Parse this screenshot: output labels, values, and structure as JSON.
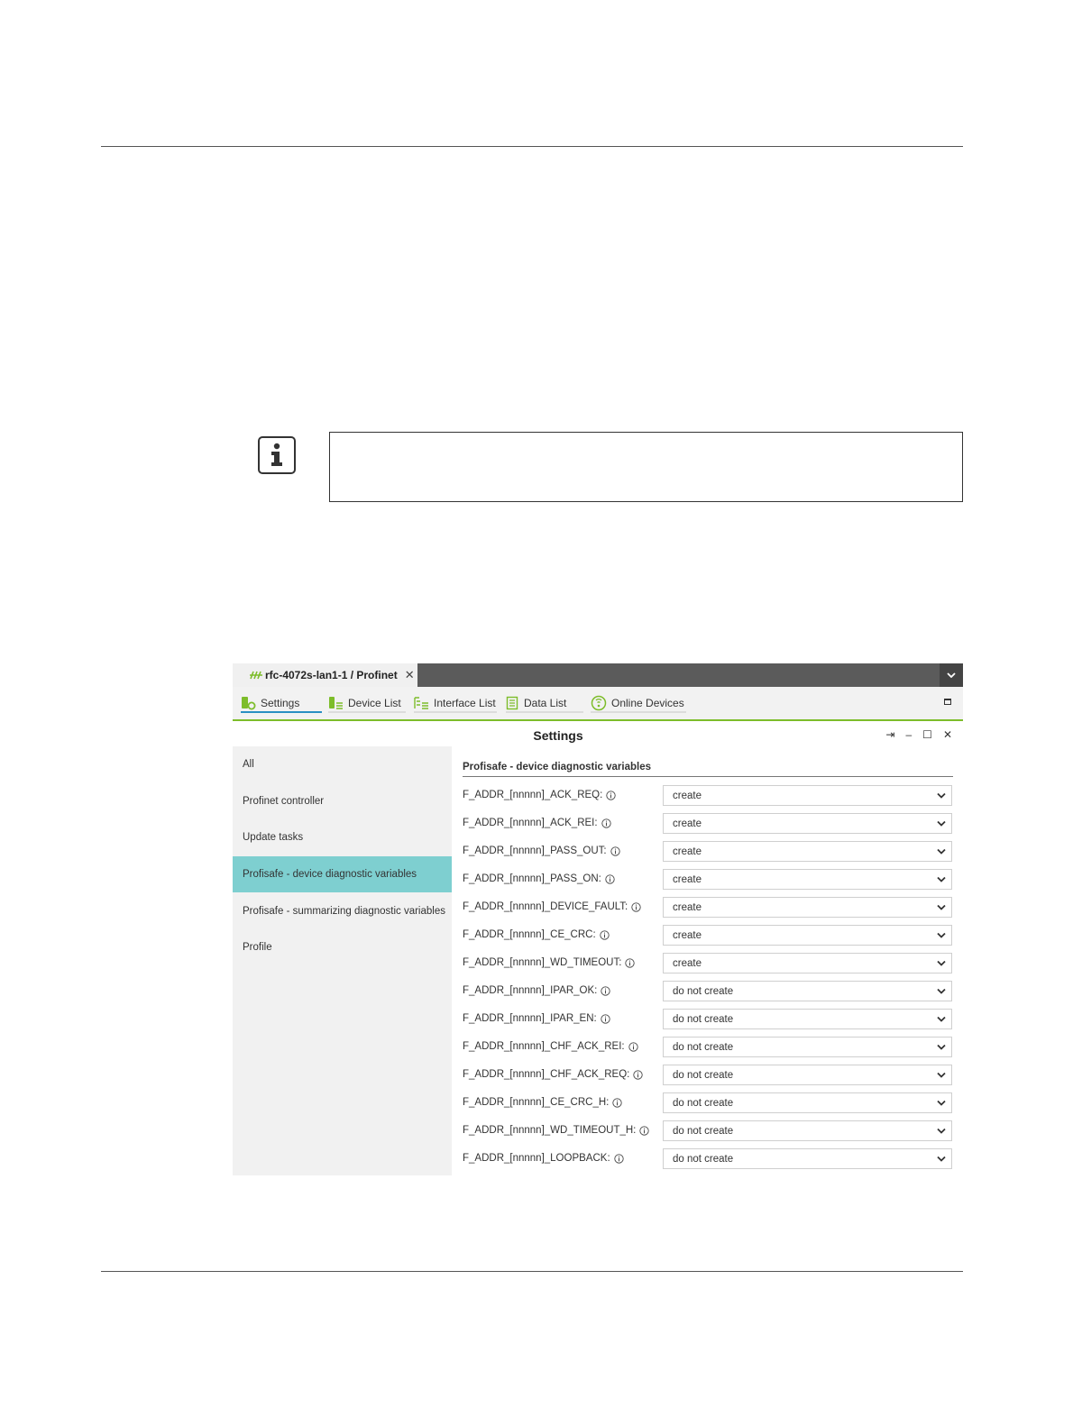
{
  "app": {
    "document_tab": {
      "title": "rfc-4072s-lan1-1 / Profinet"
    },
    "toolbar": {
      "tabs": [
        {
          "label": "Settings",
          "active": true
        },
        {
          "label": "Device List",
          "active": false
        },
        {
          "label": "Interface List",
          "active": false
        },
        {
          "label": "Data List",
          "active": false
        },
        {
          "label": "Online Devices",
          "active": false
        }
      ]
    },
    "panel": {
      "title": "Settings"
    },
    "sidebar": {
      "items": [
        {
          "label": "All",
          "selected": false
        },
        {
          "label": "Profinet controller",
          "selected": false
        },
        {
          "label": "Update tasks",
          "selected": false
        },
        {
          "label": "Profisafe - device diagnostic variables",
          "selected": true
        },
        {
          "label": "Profisafe - summarizing diagnostic variables",
          "selected": false
        },
        {
          "label": "Profile",
          "selected": false
        }
      ]
    },
    "content": {
      "section_title": "Profisafe - device diagnostic variables",
      "rows": [
        {
          "label": "F_ADDR_[nnnnn]_ACK_REQ:",
          "value": "create"
        },
        {
          "label": "F_ADDR_[nnnnn]_ACK_REI:",
          "value": "create"
        },
        {
          "label": "F_ADDR_[nnnnn]_PASS_OUT:",
          "value": "create"
        },
        {
          "label": "F_ADDR_[nnnnn]_PASS_ON:",
          "value": "create"
        },
        {
          "label": "F_ADDR_[nnnnn]_DEVICE_FAULT:",
          "value": "create"
        },
        {
          "label": "F_ADDR_[nnnnn]_CE_CRC:",
          "value": "create"
        },
        {
          "label": "F_ADDR_[nnnnn]_WD_TIMEOUT:",
          "value": "create"
        },
        {
          "label": "F_ADDR_[nnnnn]_IPAR_OK:",
          "value": "do not create"
        },
        {
          "label": "F_ADDR_[nnnnn]_IPAR_EN:",
          "value": "do not create"
        },
        {
          "label": "F_ADDR_[nnnnn]_CHF_ACK_REI:",
          "value": "do not create"
        },
        {
          "label": "F_ADDR_[nnnnn]_CHF_ACK_REQ:",
          "value": "do not create"
        },
        {
          "label": "F_ADDR_[nnnnn]_CE_CRC_H:",
          "value": "do not create"
        },
        {
          "label": "F_ADDR_[nnnnn]_WD_TIMEOUT_H:",
          "value": "do not create"
        },
        {
          "label": "F_ADDR_[nnnnn]_LOOPBACK:",
          "value": "do not create"
        }
      ]
    },
    "colors": {
      "tabbar": "#5b5b5b",
      "accent_green": "#7dbd2a",
      "active_tab_underline": "#2a8fc2",
      "sidebar_selected": "#7ecfd0"
    }
  }
}
